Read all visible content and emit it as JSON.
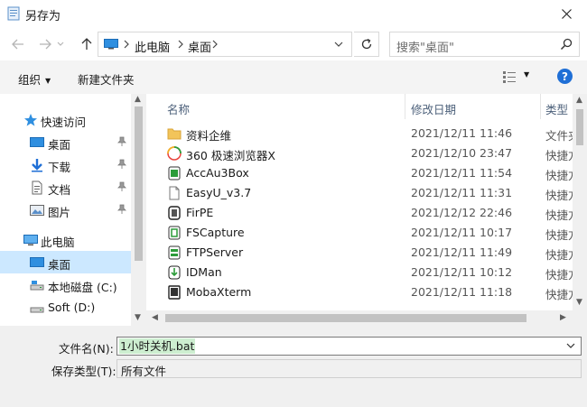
{
  "window": {
    "title": "另存为"
  },
  "address": {
    "segments": [
      "此电脑",
      "桌面"
    ]
  },
  "search": {
    "placeholder": "搜索\"桌面\""
  },
  "toolbar": {
    "organize": "组织",
    "new_folder": "新建文件夹",
    "help": "?"
  },
  "nav": {
    "items": [
      {
        "label": "快速访问",
        "icon": "star-icon"
      },
      {
        "label": "桌面",
        "icon": "desktop-icon"
      },
      {
        "label": "下载",
        "icon": "download-icon"
      },
      {
        "label": "文档",
        "icon": "document-icon"
      },
      {
        "label": "图片",
        "icon": "picture-icon"
      },
      {
        "label": "此电脑",
        "icon": "computer-icon"
      },
      {
        "label": "桌面",
        "icon": "desktop-icon"
      },
      {
        "label": "本地磁盘 (C:)",
        "icon": "drive-icon"
      },
      {
        "label": "Soft (D:)",
        "icon": "drive-icon"
      }
    ],
    "selected": 6
  },
  "columns": {
    "name": "名称",
    "date": "修改日期",
    "type": "类型"
  },
  "files": [
    {
      "name": "资料企维",
      "date": "2021/12/11 11:46",
      "type": "文件夹",
      "icon": "folder-icon"
    },
    {
      "name": "360 极速浏览器X",
      "date": "2021/12/10 23:47",
      "type": "快捷方式",
      "icon": "browser-icon"
    },
    {
      "name": "AccAu3Box",
      "date": "2021/12/11 11:54",
      "type": "快捷方式",
      "icon": "app-icon"
    },
    {
      "name": "EasyU_v3.7",
      "date": "2021/12/11 11:31",
      "type": "快捷方式",
      "icon": "file-icon"
    },
    {
      "name": "FirPE",
      "date": "2021/12/12 22:46",
      "type": "快捷方式",
      "icon": "app-icon"
    },
    {
      "name": "FSCapture",
      "date": "2021/12/11 10:17",
      "type": "快捷方式",
      "icon": "capture-icon"
    },
    {
      "name": "FTPServer",
      "date": "2021/12/11 11:49",
      "type": "快捷方式",
      "icon": "server-icon"
    },
    {
      "name": "IDMan",
      "date": "2021/12/11 10:12",
      "type": "快捷方式",
      "icon": "download-manager-icon"
    },
    {
      "name": "MobaXterm",
      "date": "2021/12/11 11:18",
      "type": "快捷方式",
      "icon": "terminal-icon"
    }
  ],
  "save": {
    "filename_label": "文件名(N):",
    "filename_value": "1小时关机.bat",
    "filetype_label": "保存类型(T):",
    "filetype_value": "所有文件"
  }
}
